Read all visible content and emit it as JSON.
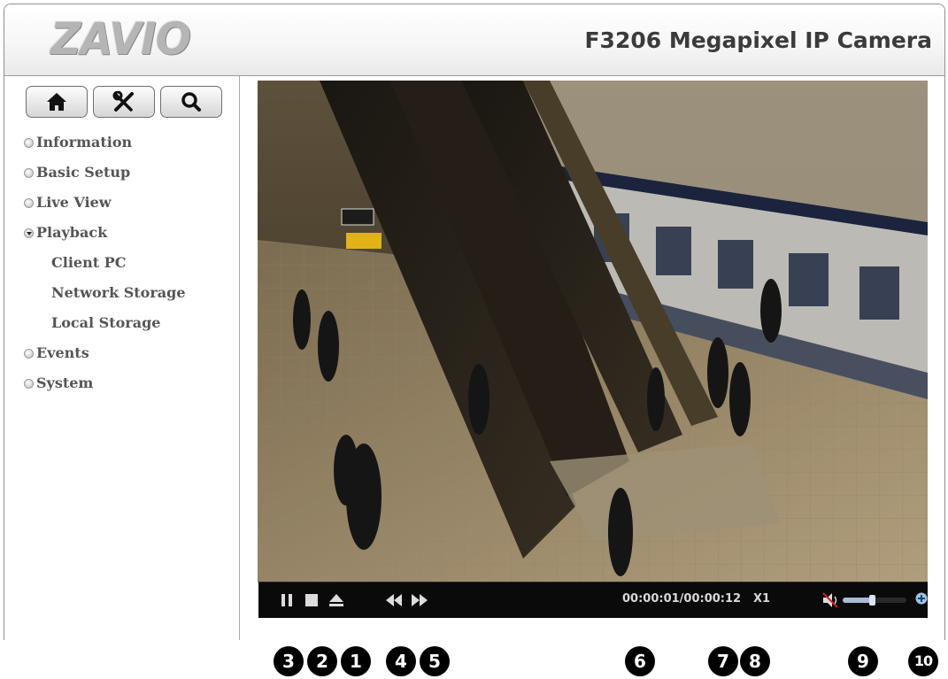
{
  "header": {
    "logo_text": "ZAVIO",
    "model_title": "F3206 Megapixel IP Camera"
  },
  "toolbar": {
    "buttons": [
      {
        "icon": "home-icon"
      },
      {
        "icon": "tools-icon"
      },
      {
        "icon": "search-icon"
      }
    ]
  },
  "sidebar": {
    "items": [
      {
        "label": "Information",
        "state": "collapsed"
      },
      {
        "label": "Basic Setup",
        "state": "collapsed"
      },
      {
        "label": "Live View",
        "state": "collapsed"
      },
      {
        "label": "Playback",
        "state": "expanded"
      },
      {
        "label": "Client PC",
        "state": "sub"
      },
      {
        "label": "Network Storage",
        "state": "sub"
      },
      {
        "label": "Local Storage",
        "state": "sub"
      },
      {
        "label": "Events",
        "state": "collapsed"
      },
      {
        "label": "System",
        "state": "collapsed"
      }
    ]
  },
  "player": {
    "video_alt": "subway station escalator recording",
    "timecode": "00:00:01/00:00:12",
    "speed": "X1",
    "volume_level": 0.5,
    "controls": [
      "pause-icon",
      "stop-icon",
      "eject-icon",
      "rewind-icon",
      "fast-forward-icon",
      "mute-icon",
      "zoom-icon"
    ]
  },
  "callouts": [
    "3",
    "2",
    "1",
    "4",
    "5",
    "6",
    "7",
    "8",
    "9",
    "10"
  ],
  "colors": {
    "control_bar": "#0a0a0a",
    "sidebar_text": "#555555",
    "header_title": "#3b3b3b"
  }
}
